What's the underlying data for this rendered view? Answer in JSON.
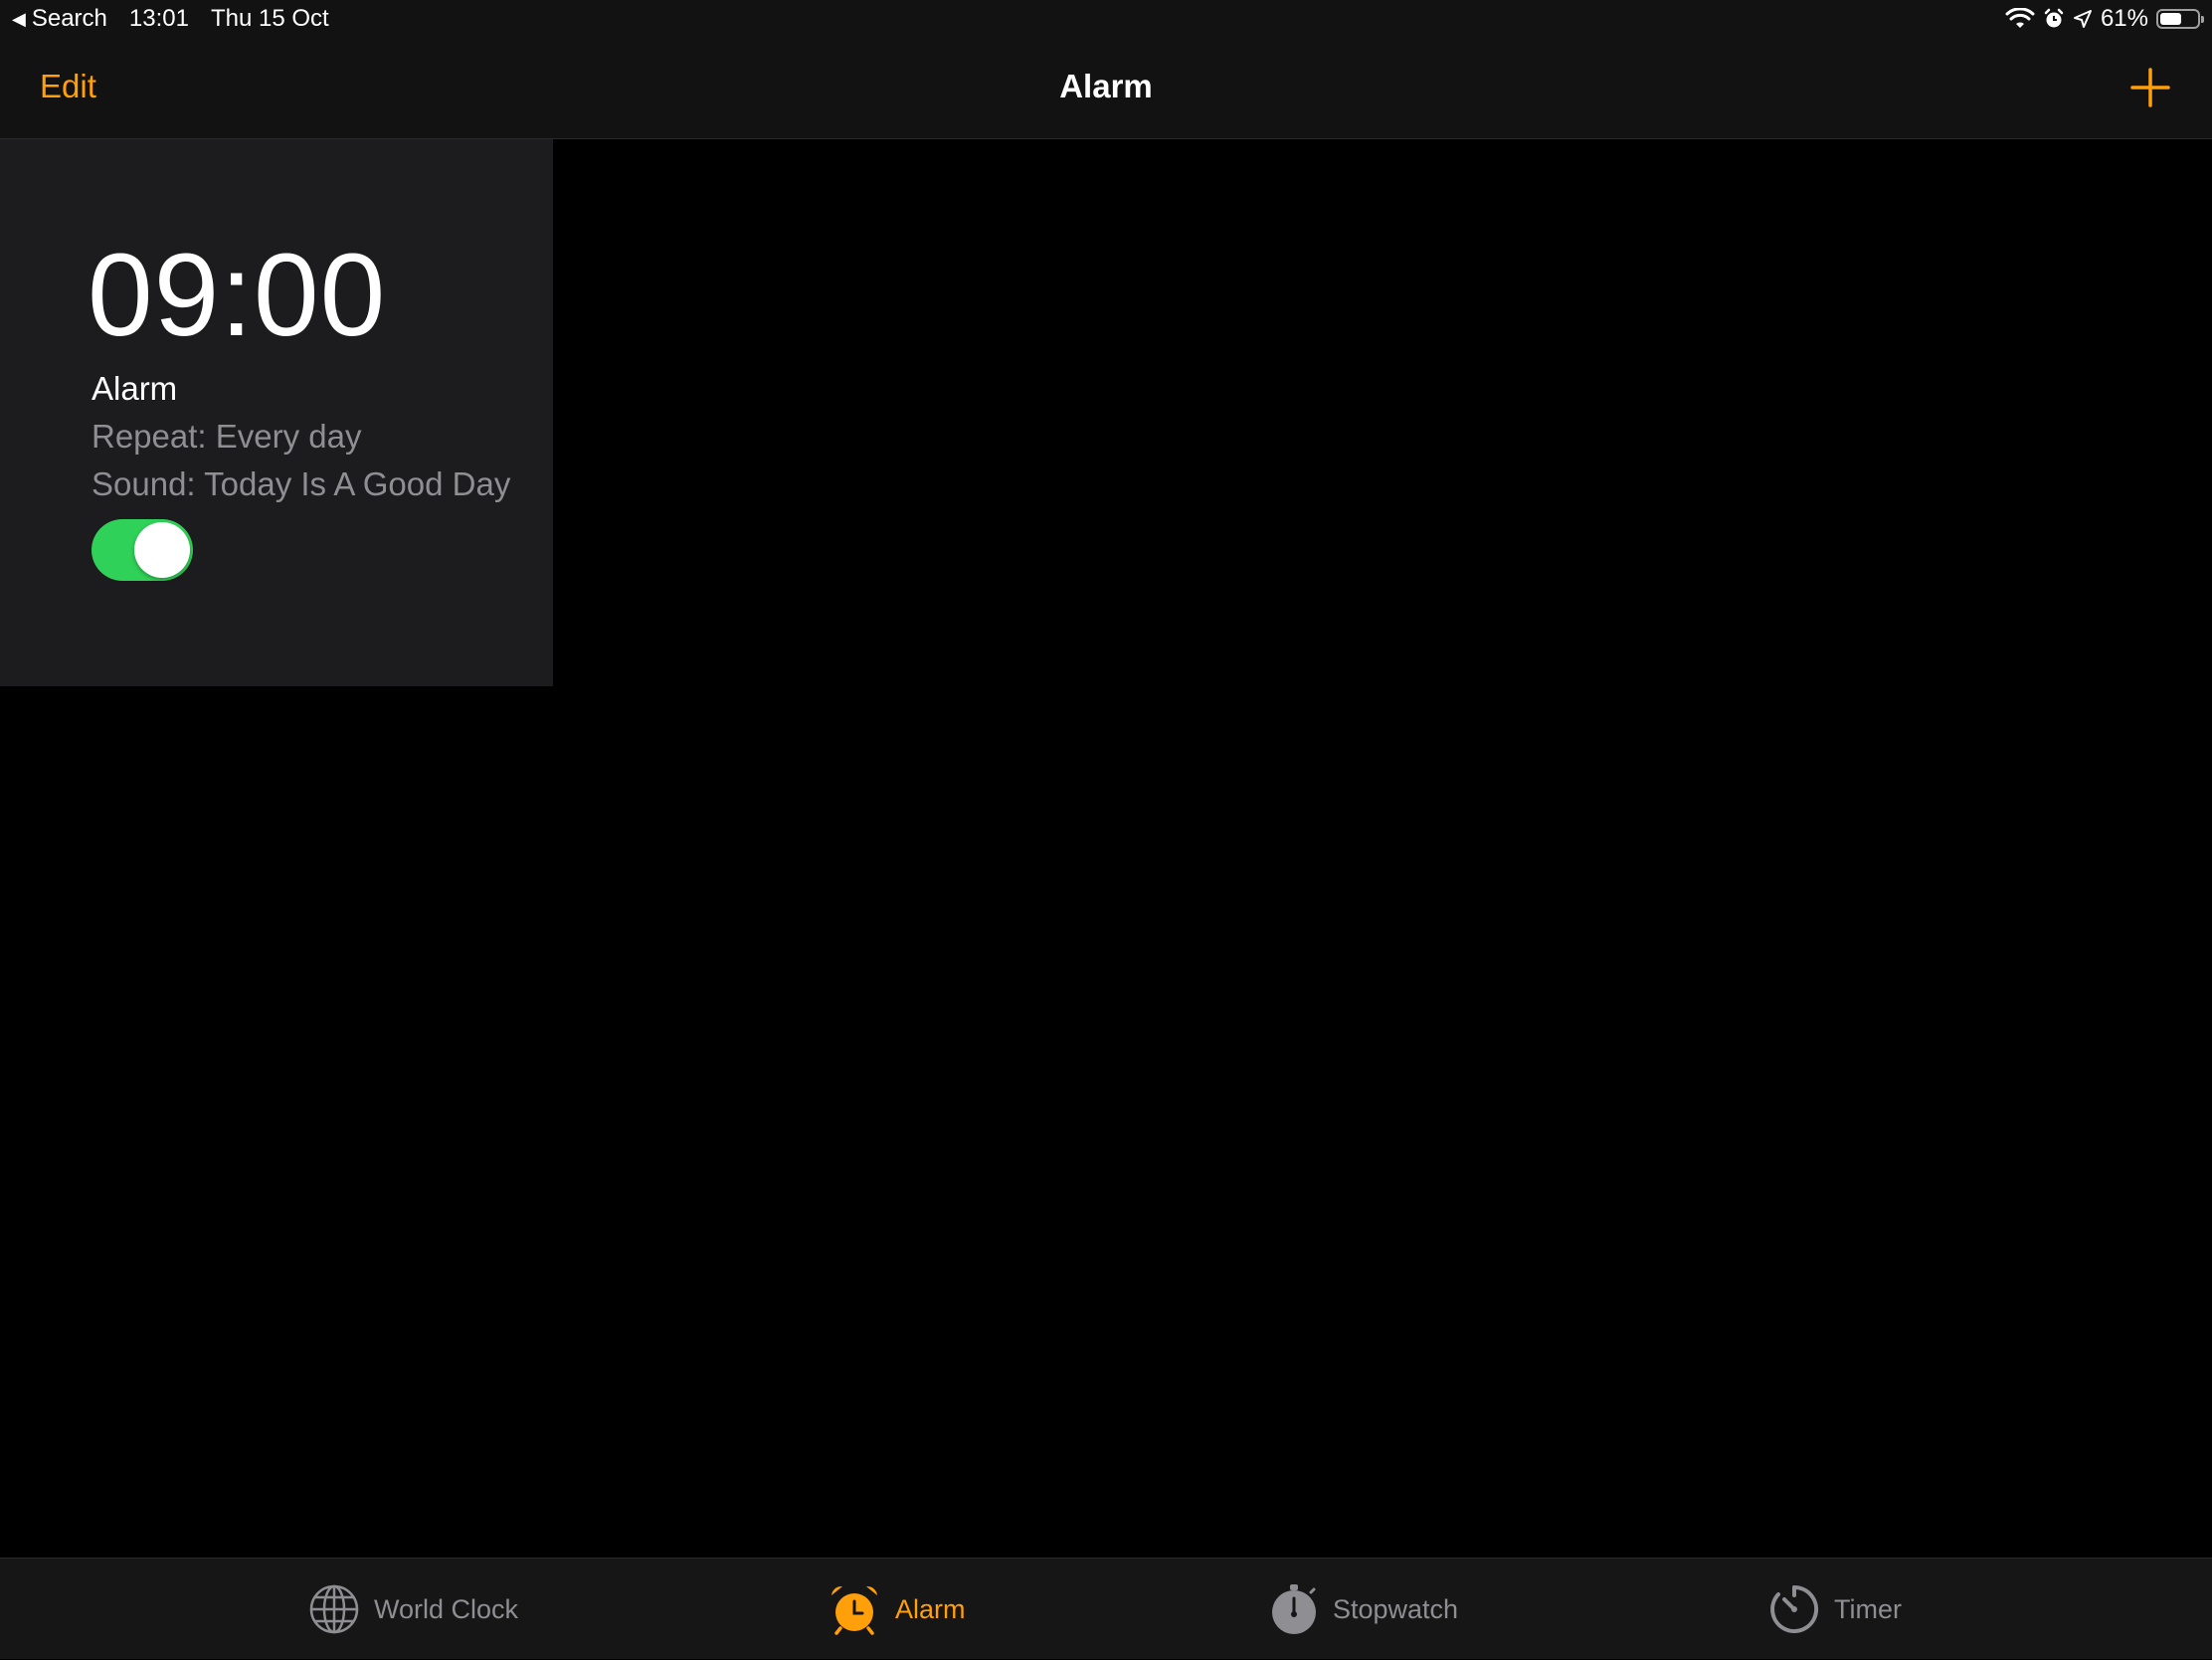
{
  "status_bar": {
    "back_label": "Search",
    "time": "13:01",
    "date": "Thu 15 Oct",
    "battery_text": "61%",
    "battery_level": 0.61
  },
  "nav": {
    "edit_label": "Edit",
    "title": "Alarm"
  },
  "alarm": {
    "time": "09:00",
    "label": "Alarm",
    "repeat": "Repeat: Every day",
    "sound": "Sound: Today Is A Good Day",
    "enabled": true
  },
  "tabs": [
    {
      "label": "World Clock",
      "icon": "globe-icon",
      "active": false
    },
    {
      "label": "Alarm",
      "icon": "alarm-clock-icon",
      "active": true
    },
    {
      "label": "Stopwatch",
      "icon": "stopwatch-icon",
      "active": false
    },
    {
      "label": "Timer",
      "icon": "timer-icon",
      "active": false
    }
  ],
  "colors": {
    "accent": "#ff9f0a",
    "toggle_on": "#30d158",
    "inactive_tab": "#8e8e93",
    "card_background": "#1c1c1e"
  }
}
